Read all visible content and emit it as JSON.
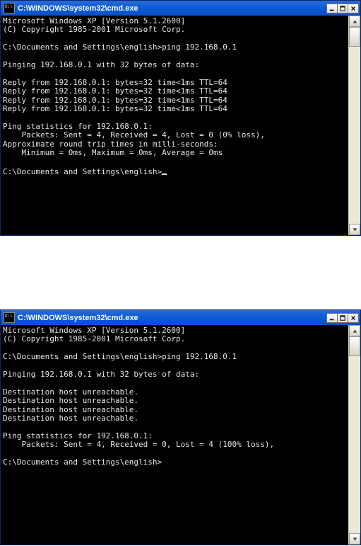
{
  "window1": {
    "title": "C:\\WINDOWS\\system32\\cmd.exe",
    "lines": [
      "Microsoft Windows XP [Version 5.1.2600]",
      "(C) Copyright 1985-2001 Microsoft Corp.",
      "",
      "C:\\Documents and Settings\\english>ping 192.168.0.1",
      "",
      "Pinging 192.168.0.1 with 32 bytes of data:",
      "",
      "Reply from 192.168.0.1: bytes=32 time<1ms TTL=64",
      "Reply from 192.168.0.1: bytes=32 time<1ms TTL=64",
      "Reply from 192.168.0.1: bytes=32 time<1ms TTL=64",
      "Reply from 192.168.0.1: bytes=32 time<1ms TTL=64",
      "",
      "Ping statistics for 192.168.0.1:",
      "    Packets: Sent = 4, Received = 4, Lost = 0 (0% loss),",
      "Approximate round trip times in milli-seconds:",
      "    Minimum = 0ms, Maximum = 0ms, Average = 0ms",
      "",
      "C:\\Documents and Settings\\english>"
    ],
    "show_cursor": true
  },
  "window2": {
    "title": "C:\\WINDOWS\\system32\\cmd.exe",
    "lines": [
      "Microsoft Windows XP [Version 5.1.2600]",
      "(C) Copyright 1985-2001 Microsoft Corp.",
      "",
      "C:\\Documents and Settings\\english>ping 192.168.0.1",
      "",
      "Pinging 192.168.0.1 with 32 bytes of data:",
      "",
      "Destination host unreachable.",
      "Destination host unreachable.",
      "Destination host unreachable.",
      "Destination host unreachable.",
      "",
      "Ping statistics for 192.168.0.1:",
      "    Packets: Sent = 4, Received = 0, Lost = 4 (100% loss),",
      "",
      "C:\\Documents and Settings\\english>"
    ],
    "show_cursor": false
  }
}
